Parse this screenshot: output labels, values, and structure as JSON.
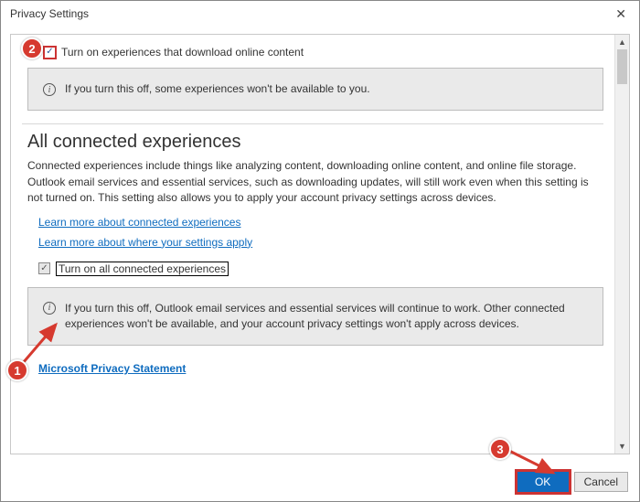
{
  "window": {
    "title": "Privacy Settings"
  },
  "section_download": {
    "checkbox_label": "Turn on experiences that download online content",
    "info": "If you turn this off, some experiences won't be available to you."
  },
  "section_connected": {
    "title": "All connected experiences",
    "description": "Connected experiences include things like analyzing content, downloading online content, and online file storage. Outlook email services and essential services, such as downloading updates, will still work even when this setting is not turned on. This setting also allows you to apply your account privacy settings across devices.",
    "link_learn_connected": "Learn more about connected experiences",
    "link_learn_apply": "Learn more about where your settings apply",
    "checkbox_label": "Turn on all connected experiences",
    "info": "If you turn this off, Outlook email services and essential services will continue to work. Other connected experiences won't be available, and your account privacy settings won't apply across devices."
  },
  "footer_link": "Microsoft Privacy Statement",
  "buttons": {
    "ok": "OK",
    "cancel": "Cancel"
  },
  "annotations": {
    "1": "1",
    "2": "2",
    "3": "3"
  }
}
